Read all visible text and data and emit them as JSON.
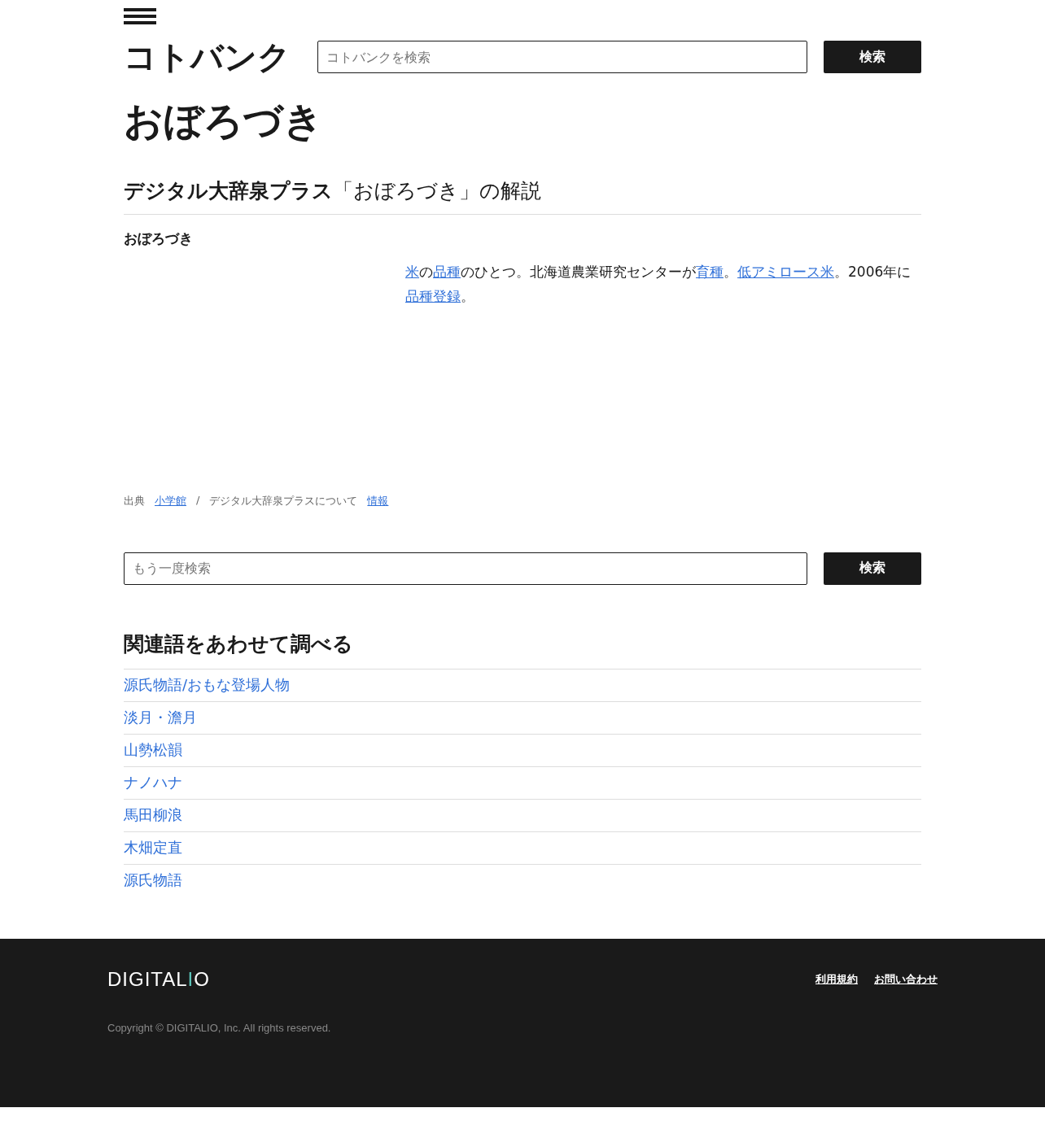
{
  "header": {
    "logo": "コトバンク",
    "search": {
      "placeholder": "コトバンクを検索"
    },
    "search_button": "検索"
  },
  "title": "おぼろづき",
  "article": {
    "source_name": "デジタル大辞泉プラス",
    "heading_rest": "「おぼろづき」の解説",
    "term": "おぼろづき",
    "body": [
      {
        "text": "米",
        "link": true
      },
      {
        "text": "の",
        "link": false
      },
      {
        "text": "品種",
        "link": true
      },
      {
        "text": "のひとつ。北海道農業研究センターが",
        "link": false
      },
      {
        "text": "育種",
        "link": true
      },
      {
        "text": "。",
        "link": false
      },
      {
        "text": "低アミロース米",
        "link": true
      },
      {
        "text": "。2006年に",
        "link": false
      },
      {
        "text": "品種登録",
        "link": true
      },
      {
        "text": "。",
        "link": false
      }
    ],
    "credit": [
      {
        "text": "出典",
        "link": false
      },
      {
        "text": "小学館",
        "link": true
      },
      {
        "text": "/",
        "link": false
      },
      {
        "text": "デジタル大辞泉プラスについて",
        "link": false
      },
      {
        "text": "情報",
        "link": true
      }
    ]
  },
  "search2": {
    "placeholder": "もう一度検索",
    "button": "検索"
  },
  "related": {
    "heading": "関連語をあわせて調べる",
    "items": [
      "源氏物語/おもな登場人物",
      "淡月・澹月",
      "山勢松韻",
      "ナノハナ",
      "馬田柳浪",
      "木畑定直",
      "源氏物語"
    ]
  },
  "footer": {
    "logo": "DIGITALIO",
    "links": [
      "利用規約",
      "お問い合わせ"
    ],
    "copyright": "Copyright © DIGITALIO, Inc. All rights reserved."
  }
}
